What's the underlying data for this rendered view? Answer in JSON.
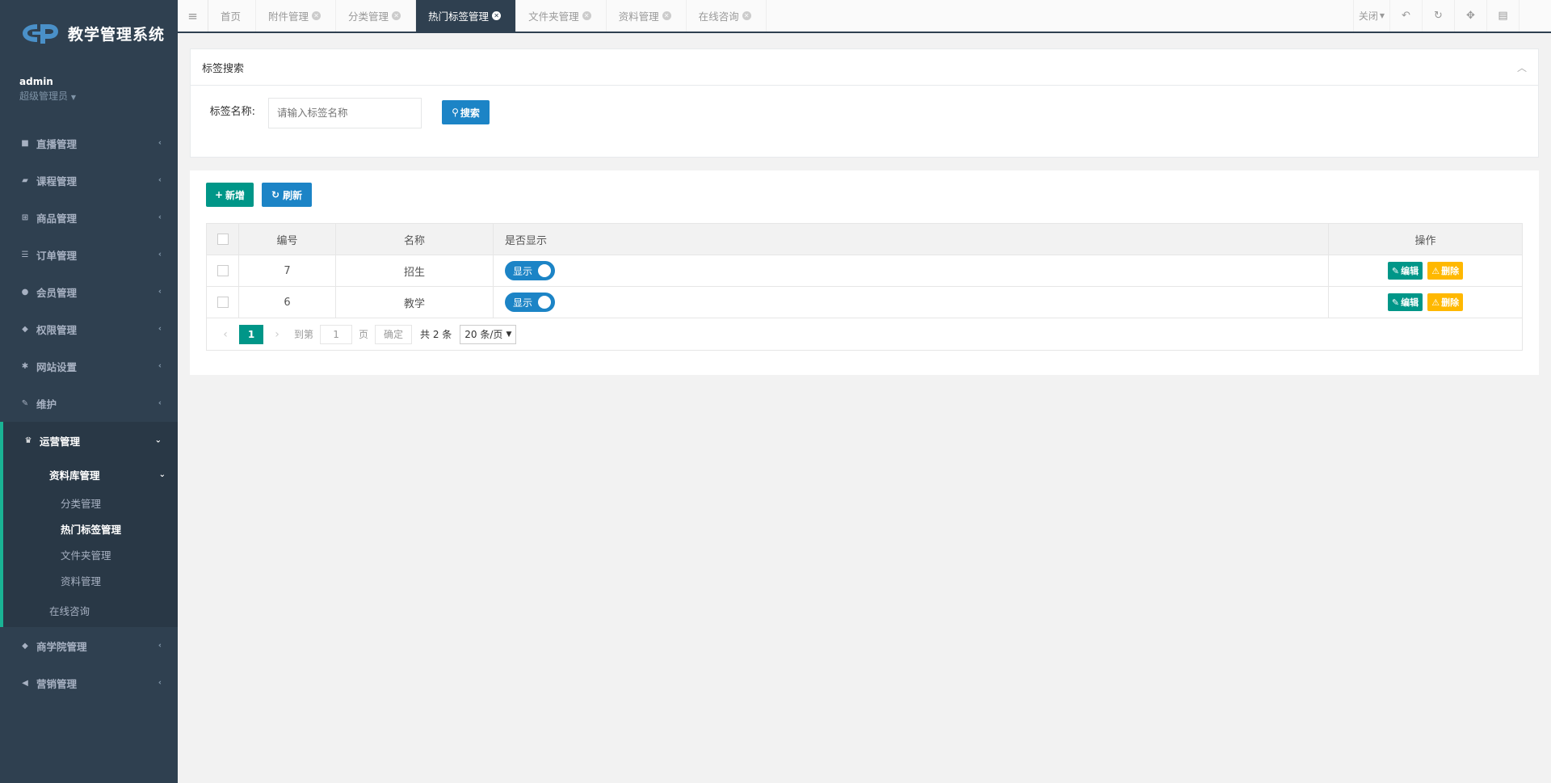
{
  "app": {
    "title": "教学管理系统"
  },
  "user": {
    "name": "admin",
    "role": "超级管理员"
  },
  "sidebar": {
    "items": [
      {
        "label": "直播管理",
        "icon": "video-icon"
      },
      {
        "label": "课程管理",
        "icon": "book-icon"
      },
      {
        "label": "商品管理",
        "icon": "cart-icon"
      },
      {
        "label": "订单管理",
        "icon": "list-icon"
      },
      {
        "label": "会员管理",
        "icon": "user-icon"
      },
      {
        "label": "权限管理",
        "icon": "users-icon"
      },
      {
        "label": "网站设置",
        "icon": "gear-icon"
      },
      {
        "label": "维护",
        "icon": "wrench-icon"
      }
    ],
    "active_group": {
      "label": "运营管理",
      "icon": "trophy-icon",
      "sub_group": "资料库管理",
      "sub_items": [
        "分类管理",
        "热门标签管理",
        "文件夹管理",
        "资料管理"
      ],
      "active_sub": "热门标签管理",
      "standalone": "在线咨询"
    },
    "items_after": [
      {
        "label": "商学院管理",
        "icon": "users-icon"
      },
      {
        "label": "营销管理",
        "icon": "megaphone-icon"
      }
    ]
  },
  "tabs": [
    {
      "label": "首页",
      "closable": false
    },
    {
      "label": "附件管理",
      "closable": true
    },
    {
      "label": "分类管理",
      "closable": true
    },
    {
      "label": "热门标签管理",
      "closable": true,
      "active": true
    },
    {
      "label": "文件夹管理",
      "closable": true
    },
    {
      "label": "资料管理",
      "closable": true
    },
    {
      "label": "在线咨询",
      "closable": true
    }
  ],
  "topbar": {
    "close_label": "关闭"
  },
  "search_panel": {
    "title": "标签搜索",
    "field_label": "标签名称:",
    "placeholder": "请输入标签名称",
    "search_button": "搜索"
  },
  "toolbar": {
    "add_label": "新增",
    "refresh_label": "刷新"
  },
  "table": {
    "headers": {
      "id": "编号",
      "name": "名称",
      "show": "是否显示",
      "ops": "操作"
    },
    "rows": [
      {
        "id": "7",
        "name": "招生",
        "show": "显示"
      },
      {
        "id": "6",
        "name": "教学",
        "show": "显示"
      }
    ],
    "edit_label": "编辑",
    "delete_label": "删除"
  },
  "pager": {
    "current": "1",
    "goto_prefix": "到第",
    "goto_value": "1",
    "goto_suffix": "页",
    "confirm": "确定",
    "total": "共 2 条",
    "page_size": "20 条/页"
  },
  "colors": {
    "sidebar": "#2f4050",
    "primary": "#009688",
    "blue": "#1c84c6",
    "warn": "#ffb800"
  }
}
